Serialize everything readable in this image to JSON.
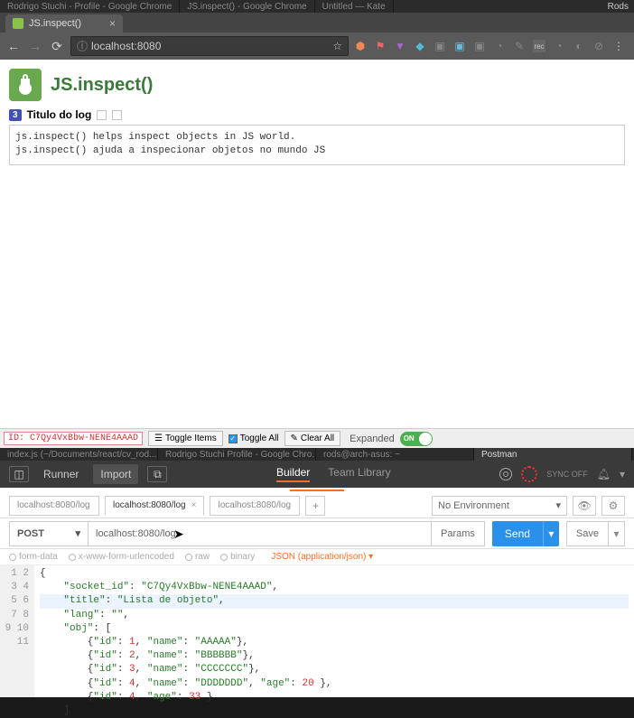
{
  "os_taskbar_top": {
    "tasks": [
      "Rodrigo Stuchi - Profile - Google Chrome",
      "JS.inspect() - Google Chrome",
      "Untitled  —  Kate"
    ],
    "right": "Rods"
  },
  "chrome": {
    "tab_title": "JS.inspect()",
    "url": "localhost:8080",
    "star": "☆",
    "icons": [
      "⬢",
      "⚑",
      "◆",
      "◆",
      "▣",
      "▣",
      "▣",
      "◔",
      "✎",
      "—",
      "◔",
      "⊘",
      "⋮"
    ]
  },
  "jsinspect": {
    "title": "JS.inspect()",
    "badge": "3",
    "log_title": "Titulo do log",
    "log_body": "js.inspect() helps inspect objects in JS world.\njs.inspect() ajuda a inspecionar objetos no mundo JS"
  },
  "controls": {
    "id_label": "ID: C7Qy4VxBbw-NENE4AAAD",
    "toggle_items": "Toggle Items",
    "toggle_all": "Toggle All",
    "clear_all": "Clear All",
    "expanded": "Expanded",
    "on": "ON"
  },
  "os_taskbar_mid": {
    "tasks": [
      "index.js (~/Documents/react/cv_rod...",
      "Rodrigo Stuchi Profile - Google Chro...",
      "rods@arch-asus: ~",
      "Postman"
    ],
    "active_index": 3
  },
  "postman": {
    "runner": "Runner",
    "import": "Import",
    "builder": "Builder",
    "team_library": "Team Library",
    "sync": "SYNC OFF",
    "tabs": [
      "localhost:8080/log",
      "localhost:8080/log",
      "localhost:8080/log"
    ],
    "active_tab": 1,
    "add": "+",
    "env": "No Environment",
    "method": "POST",
    "url": "localhost:8080/log",
    "params": "Params",
    "send": "Send",
    "save": "Save",
    "body_types": [
      "form-data",
      "x-www-form-urlencoded",
      "raw",
      "binary"
    ],
    "selected_type": "raw",
    "content_type": "JSON (application/json)",
    "editor_lines": [
      "{",
      "    \"socket_id\": \"C7Qy4VxBbw-NENE4AAAD\",",
      "    \"title\": \"Lista de objeto\",",
      "    \"lang\": \"\",",
      "    \"obj\": [",
      "        {\"id\": 1, \"name\": \"AAAAA\"},",
      "        {\"id\": 2, \"name\": \"BBBBBB\"},",
      "        {\"id\": 3, \"name\": \"CCCCCCC\"},",
      "        {\"id\": 4, \"name\": \"DDDDDDD\", \"age\": 20 },",
      "        {\"id\": 4, \"age\": 33 }",
      "    ]"
    ],
    "highlighted_line": 3
  }
}
